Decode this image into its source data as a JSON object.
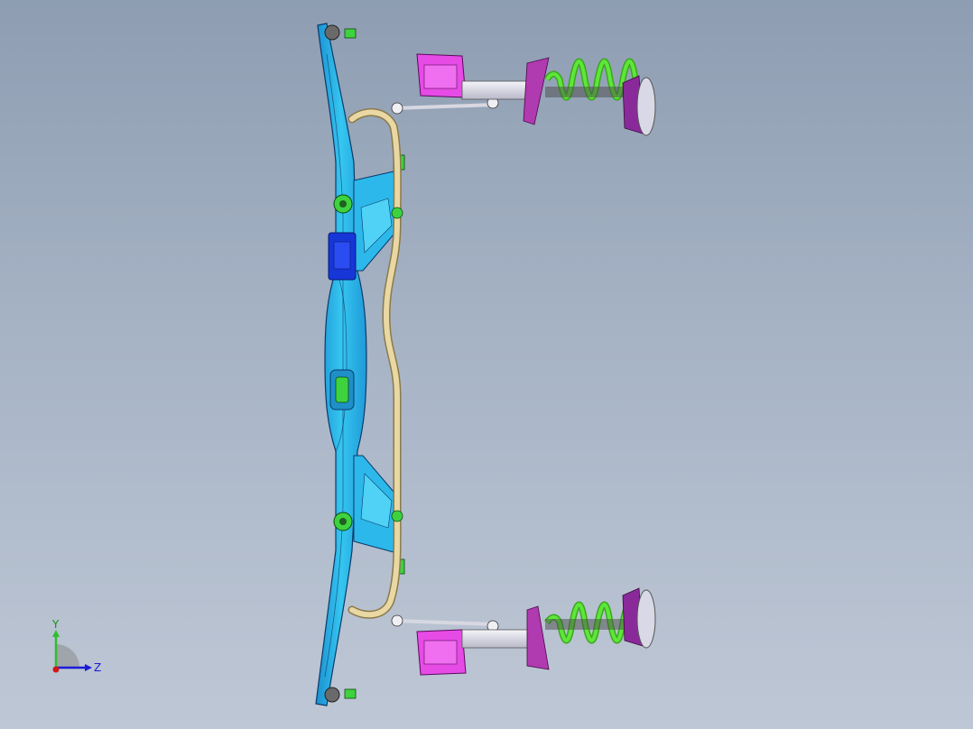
{
  "viewport": {
    "background_top": "#8e9db2",
    "background_bottom": "#bec7d5"
  },
  "colors": {
    "subframe": "#29b6e8",
    "subframe_dark": "#1f8fc7",
    "mount_block": "#1636d8",
    "stabilizer_bar": "#e8d6a0",
    "spring": "#4bcc2a",
    "strut_body": "#e9e9f2",
    "knuckle": "#e64be6",
    "bushing": "#3fd23f"
  },
  "triad": {
    "y_label": "Y",
    "z_label": "Z",
    "icon": "axis-triad-icon"
  }
}
